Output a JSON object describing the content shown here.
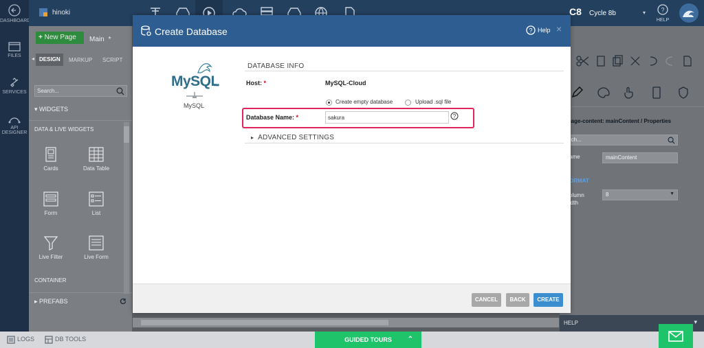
{
  "left_nav": {
    "dashboard": "DASHBOARD",
    "files": "FILES",
    "services": "SERVICES",
    "api_designer_1": "API",
    "api_designer_2": "DESIGNER"
  },
  "top_bar": {
    "project_name": "hinoki",
    "cycle_badge": "C8",
    "cycle_label": "Cycle 8b",
    "help": "HELP"
  },
  "left_panel": {
    "new_page": "New Page",
    "page_tab": "Main",
    "page_tab_mark": "*",
    "tabs": [
      "DESIGN",
      "MARKUP",
      "SCRIPT"
    ],
    "search_placeholder": "Search...",
    "widgets_header": "WIDGETS",
    "data_live_header": "DATA & LIVE WIDGETS",
    "widgets": [
      "Cards",
      "Data Table",
      "Form",
      "List",
      "Live Filter",
      "Live Form"
    ],
    "container_header": "CONTAINER",
    "prefabs_header": "PREFABS"
  },
  "right_panel": {
    "properties_title": "m-page-content: mainContent / Properties",
    "search_placeholder": "earch...",
    "name_label": "ame",
    "name_value": "mainContent",
    "format_header": "ORMAT",
    "column_width_label_1": "olumn",
    "column_width_label_2": "idth",
    "column_width_value": "8",
    "help_header": "HELP"
  },
  "bottom_bar": {
    "logs": "LOGS",
    "db_tools": "DB TOOLS",
    "guided_tours": "GUIDED TOURS"
  },
  "modal": {
    "title": "Create Database",
    "help": "Help",
    "close": "×",
    "vendor_name": "MySQL",
    "logo_text": "MySQL",
    "logo_tm": "TM",
    "section_title": "DATABASE INFO",
    "host_label": "Host:",
    "host_value": "MySQL-Cloud",
    "radio_empty": "Create empty database",
    "radio_upload": "Upload .sql file",
    "db_name_label": "Database Name:",
    "db_name_value": "sakura",
    "required_mark": "*",
    "advanced": "ADVANCED SETTINGS",
    "buttons": {
      "cancel": "CANCEL",
      "back": "BACK",
      "create": "CREATE"
    }
  },
  "colors": {
    "modal_header": "#2e5d91",
    "create_button": "#3b8fd0",
    "highlight": "#e0245e",
    "guided_tours": "#1fc46a"
  }
}
